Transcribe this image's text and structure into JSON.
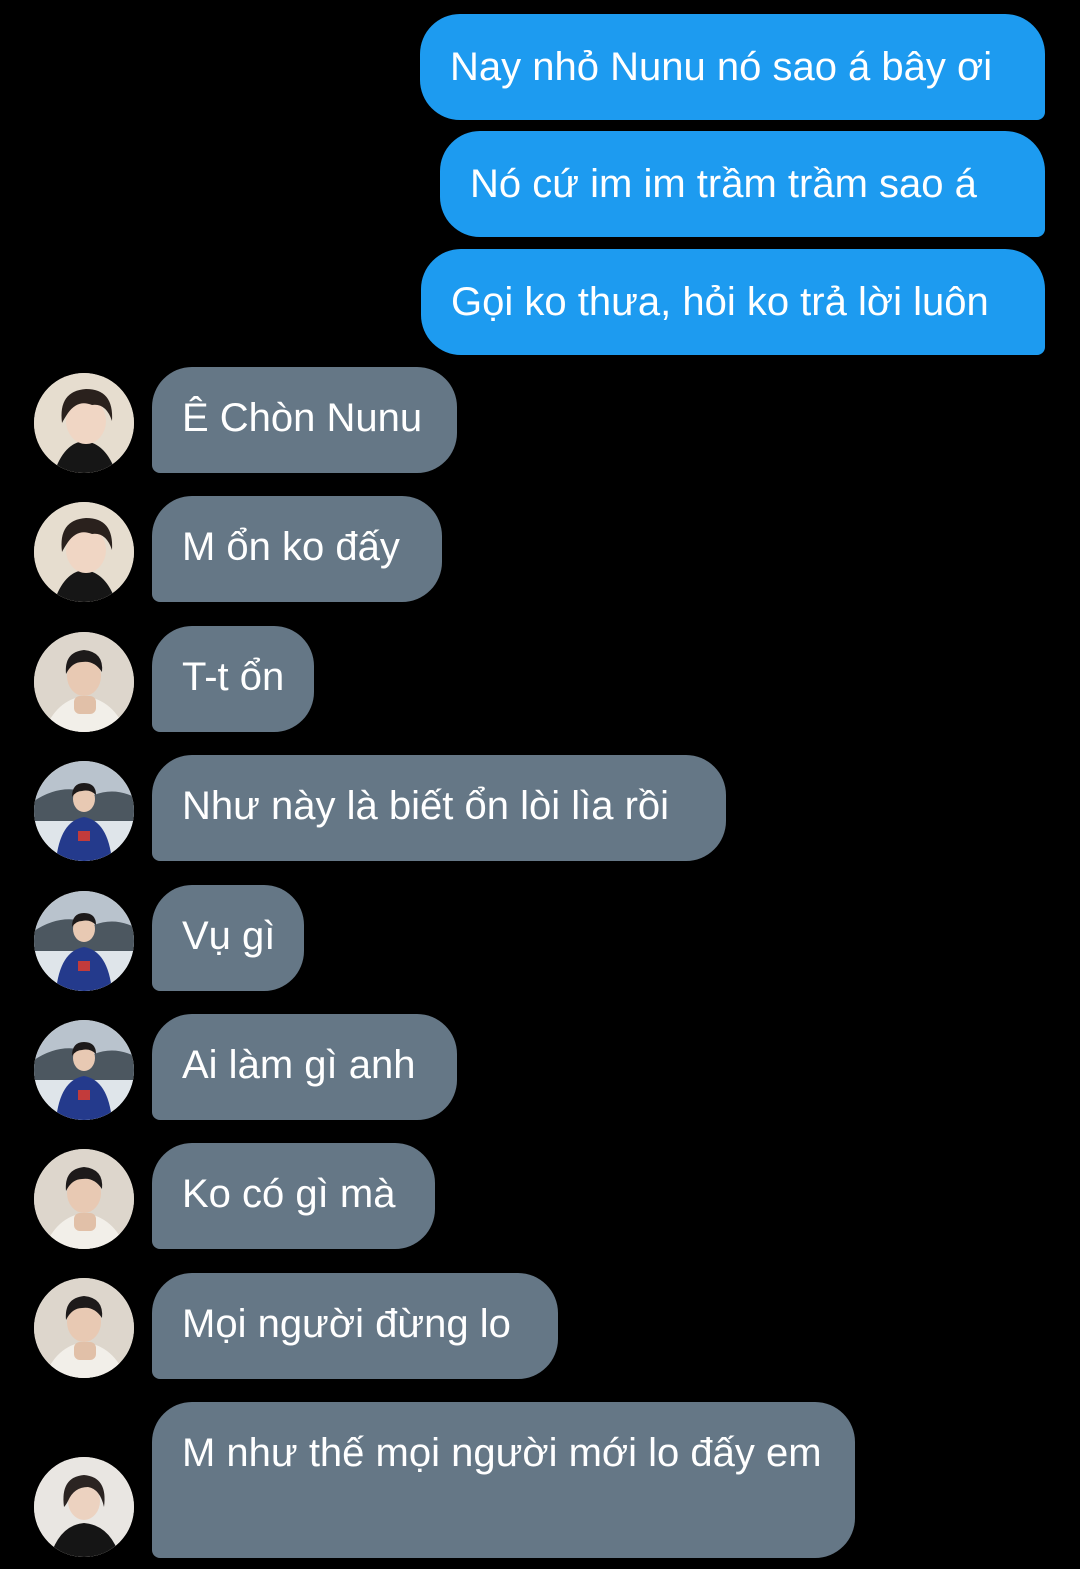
{
  "colors": {
    "background": "#000000",
    "outgoing_bubble": "#1d9bf0",
    "incoming_bubble": "#657786",
    "text": "#ffffff"
  },
  "messages": [
    {
      "direction": "outgoing",
      "text": "Nay nhỏ Nunu nó sao á bây ơi"
    },
    {
      "direction": "outgoing",
      "text": "Nó cứ im im trầm trầm sao á"
    },
    {
      "direction": "outgoing",
      "text": "Gọi ko thưa, hỏi ko trả lời luôn"
    },
    {
      "direction": "incoming",
      "avatar": "avatar-dark-hair",
      "text": "Ê Chòn Nunu"
    },
    {
      "direction": "incoming",
      "avatar": "avatar-dark-hair",
      "text": "M ổn ko đấy"
    },
    {
      "direction": "incoming",
      "avatar": "avatar-light-sweater",
      "text": "T-t ổn"
    },
    {
      "direction": "incoming",
      "avatar": "avatar-blue-sweater",
      "text": "Như này là biết ổn lòi lìa rồi"
    },
    {
      "direction": "incoming",
      "avatar": "avatar-blue-sweater",
      "text": "Vụ gì"
    },
    {
      "direction": "incoming",
      "avatar": "avatar-blue-sweater",
      "text": "Ai làm gì anh"
    },
    {
      "direction": "incoming",
      "avatar": "avatar-light-sweater",
      "text": "Ko có gì mà"
    },
    {
      "direction": "incoming",
      "avatar": "avatar-light-sweater",
      "text": "Mọi người đừng lo"
    },
    {
      "direction": "incoming",
      "avatar": "avatar-black-shirt",
      "text": "M như thế mọi người mới lo đấy em"
    }
  ]
}
